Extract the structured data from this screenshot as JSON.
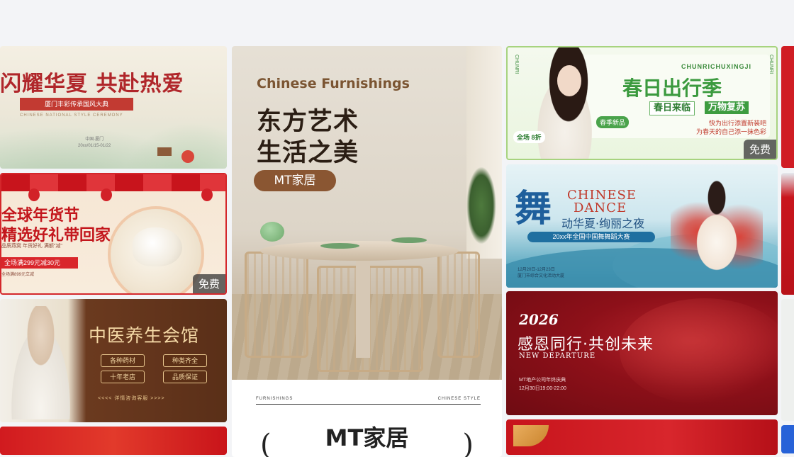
{
  "cards": {
    "heritage": {
      "title": "闪耀华夏 共赴热爱",
      "subtitle": "厦门丰彩传承国风大典",
      "subtitle_en": "CHINESE NATIONAL STYLE CEREMONY",
      "location": "中国·厦门",
      "date": "20xx/01/15-01/22"
    },
    "new_year": {
      "line1": "全球年货节",
      "line2": "精选好礼带回家",
      "small_text": "品质燕窝 年货好礼 满额\"减\"",
      "promo": "全场满299元减30元",
      "tag": "全场满899元立减",
      "badge": "免费"
    },
    "tcm": {
      "title": "中医养生会馆",
      "pills": [
        "各种药材",
        "种类齐全",
        "十年老店",
        "品质保证"
      ],
      "footer": "<<<< 详情咨询客服 >>>>"
    },
    "furnishings": {
      "en_title": "Chinese Furnishings",
      "cn_line1": "东方艺术",
      "cn_line2": "生活之美",
      "brand_pill": "MT家居",
      "label_left": "FURNISHINGS",
      "label_right": "CHINESE STYLE",
      "brand_big": "MT家居",
      "paren_left": "(",
      "paren_right": ")"
    },
    "spring": {
      "pinyin": "CHUNRICHUXINGJI",
      "title": "春日出行季",
      "pill1": "春日来临",
      "pill2": "万物复苏",
      "note_line1": "快为出行添置新装吧",
      "note_line2": "为春天的自己添一抹色彩",
      "new_tag": "春季新品",
      "discount": "全场 8折",
      "vertical_left": "CHUNRI",
      "vertical_right": "CHUNRI",
      "badge": "免费"
    },
    "dance": {
      "char": "舞",
      "en1": "CHINESE",
      "en2": "DANCE",
      "line1": "动华夏·绚丽之夜",
      "banner": "20xx年全国中国舞舞蹈大赛",
      "meta_line1": "12月20日-12月23日",
      "meta_line2": "厦门市综合文化活动大厦"
    },
    "thanks": {
      "year": "2026",
      "title": "感恩同行·共创未来",
      "en": "NEW DEPARTURE",
      "meta_line1": "MT地产公司年终庆典",
      "meta_line2": "12月30日19:00-22:00"
    }
  }
}
